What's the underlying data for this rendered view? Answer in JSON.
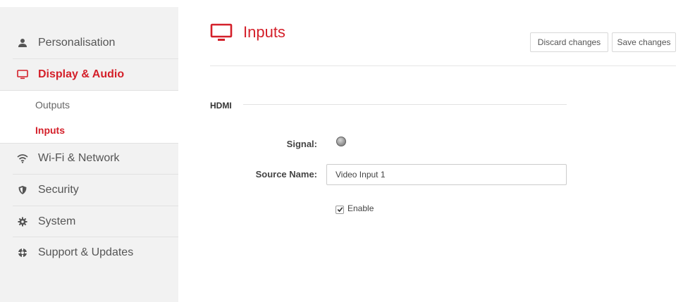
{
  "sidebar": {
    "items": [
      {
        "label": "Personalisation",
        "icon": "user-icon"
      },
      {
        "label": "Display & Audio",
        "icon": "monitor-icon",
        "active": true
      },
      {
        "label": "Wi-Fi & Network",
        "icon": "wifi-icon"
      },
      {
        "label": "Security",
        "icon": "shield-icon"
      },
      {
        "label": "System",
        "icon": "gear-icon"
      },
      {
        "label": "Support & Updates",
        "icon": "lifebuoy-icon"
      }
    ],
    "subitems": [
      {
        "label": "Outputs"
      },
      {
        "label": "Inputs",
        "active": true
      }
    ]
  },
  "header": {
    "title": "Inputs",
    "icon": "monitor-icon",
    "discard_label": "Discard changes",
    "save_label": "Save changes"
  },
  "section": {
    "title": "HDMI",
    "signal_label": "Signal:",
    "source_name_label": "Source Name:",
    "source_name_value": "Video Input 1",
    "enable_label": "Enable",
    "enable_checked": true
  },
  "colors": {
    "accent": "#d4202a",
    "sidebar_bg": "#f2f2f2",
    "text": "#555555"
  }
}
